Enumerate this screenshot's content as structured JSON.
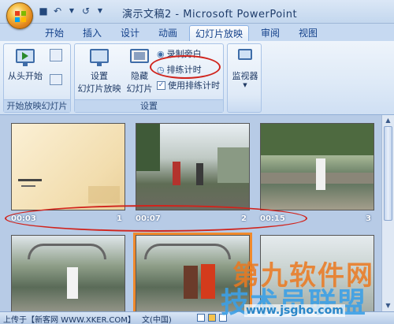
{
  "window": {
    "title": "演示文稿2 - Microsoft PowerPoint"
  },
  "tabs": [
    {
      "label": "开始"
    },
    {
      "label": "插入"
    },
    {
      "label": "设计"
    },
    {
      "label": "动画"
    },
    {
      "label": "幻灯片放映"
    },
    {
      "label": "审阅"
    },
    {
      "label": "视图"
    }
  ],
  "ribbon": {
    "start_group": {
      "label": "开始放映幻灯片",
      "from_start": "从头开始"
    },
    "setup_group": {
      "label": "设置",
      "setup_show": "设置\n幻灯片放映",
      "setup_show_l1": "设置",
      "setup_show_l2": "幻灯片放映",
      "hide_slide_l1": "隐藏",
      "hide_slide_l2": "幻灯片",
      "record_narration": "录制旁白",
      "rehearse_timings": "排练计时",
      "use_timings": "使用排练计时",
      "use_timings_checked": true
    },
    "monitor_group": {
      "monitor": "监视器"
    }
  },
  "slides": [
    {
      "time": "00:03",
      "number": "1"
    },
    {
      "time": "00:07",
      "number": "2"
    },
    {
      "time": "00:15",
      "number": "3"
    }
  ],
  "statusbar": {
    "left_text": "上传于【新客网 WWW.XKER.COM】",
    "lang": "文(中国)"
  },
  "watermark": {
    "line1": "第九软件网",
    "line2": "技术员联盟",
    "url": "www.jsgho.com"
  },
  "colors": {
    "accent": "#15428b",
    "annotation": "#d0231c",
    "selection": "#f08a2c"
  }
}
